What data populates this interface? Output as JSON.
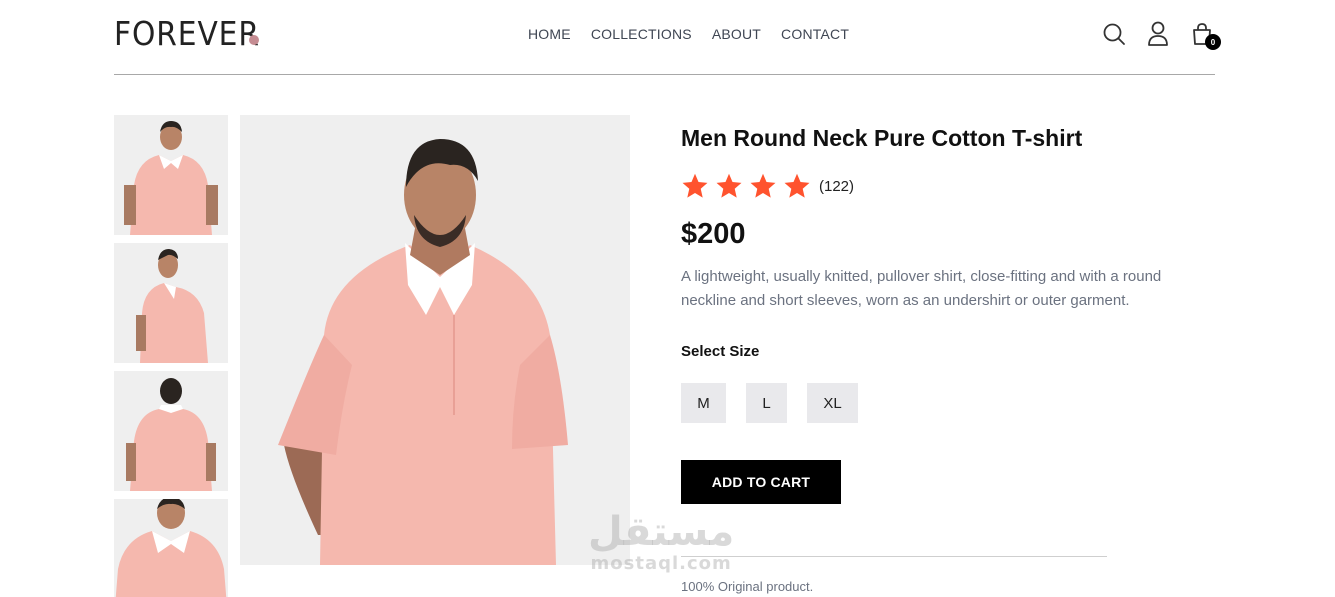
{
  "brand": {
    "logo": "FOREVER",
    "dot_color": "#c58c92"
  },
  "nav": {
    "items": [
      {
        "label": "HOME"
      },
      {
        "label": "COLLECTIONS"
      },
      {
        "label": "ABOUT"
      },
      {
        "label": "CONTACT"
      }
    ]
  },
  "header_icons": {
    "search": "search-icon",
    "profile": "user-icon",
    "cart": "shopping-bag-icon",
    "cart_count": "0"
  },
  "product": {
    "title": "Men Round Neck Pure Cotton T-shirt",
    "rating": 4,
    "review_count": "(122)",
    "price": "$200",
    "description": "A lightweight, usually knitted, pullover shirt, close-fitting and with a round neckline and short sleeves, worn as an undershirt or outer garment.",
    "size_label": "Select Size",
    "sizes": [
      "M",
      "L",
      "XL"
    ],
    "add_to_cart": "ADD TO CART",
    "note": "100% Original product.",
    "star_color": "#ff532e",
    "shirt_color": "#f5b8ae"
  },
  "watermark": {
    "arabic": "مستقل",
    "latin": "mostaql.com"
  }
}
